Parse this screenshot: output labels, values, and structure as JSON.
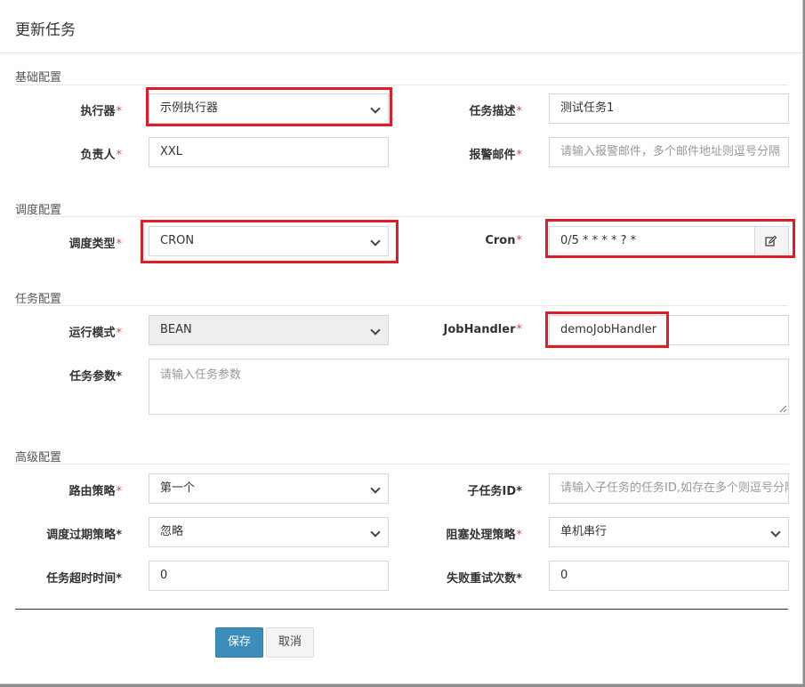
{
  "modal": {
    "title": "更新任务"
  },
  "sections": {
    "basic": "基础配置",
    "schedule": "调度配置",
    "task": "任务配置",
    "advanced": "高级配置"
  },
  "fields": {
    "executor": {
      "label": "执行器",
      "required": "*",
      "value": "示例执行器"
    },
    "job_desc": {
      "label": "任务描述",
      "required": "*",
      "value": "测试任务1"
    },
    "author": {
      "label": "负责人",
      "required": "*",
      "value": "XXL"
    },
    "alarm_email": {
      "label": "报警邮件",
      "required": "*",
      "placeholder": "请输入报警邮件，多个邮件地址则逗号分隔"
    },
    "schedule_type": {
      "label": "调度类型",
      "required": "*",
      "value": "CRON"
    },
    "cron": {
      "label": "Cron",
      "required": "*",
      "value": "0/5 * * * * ? *"
    },
    "glue_type": {
      "label": "运行模式",
      "required": "*",
      "value": "BEAN"
    },
    "job_handler": {
      "label": "JobHandler",
      "required": "*",
      "value": "demoJobHandler"
    },
    "job_param": {
      "label": "任务参数",
      "required": "*",
      "placeholder": "请输入任务参数"
    },
    "route_strategy": {
      "label": "路由策略",
      "required": "*",
      "value": "第一个"
    },
    "child_job_id": {
      "label": "子任务ID",
      "required": "*",
      "placeholder": "请输入子任务的任务ID,如存在多个则逗号分隔"
    },
    "misfire_strategy": {
      "label": "调度过期策略",
      "required": "*",
      "value": "忽略"
    },
    "block_strategy": {
      "label": "阻塞处理策略",
      "required": "*",
      "value": "单机串行"
    },
    "timeout": {
      "label": "任务超时时间",
      "required": "*",
      "value": "0"
    },
    "fail_retry": {
      "label": "失败重试次数",
      "required": "*",
      "value": "0"
    }
  },
  "buttons": {
    "save": "保存",
    "cancel": "取消"
  },
  "colors": {
    "highlight": "#e01c26",
    "primary": "#3c8dbc",
    "required": "#dd4b39"
  },
  "icons": {
    "cron_edit": "edit-icon"
  }
}
